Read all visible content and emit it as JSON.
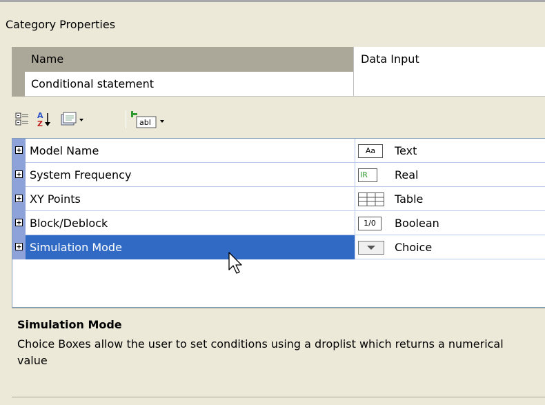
{
  "panel": {
    "title": "Category Properties"
  },
  "category_properties": {
    "header": {
      "label": "Name",
      "value": "Data Input"
    },
    "rows": [
      {
        "label": "Conditional statement",
        "value": ""
      }
    ]
  },
  "toolbar": {
    "categorized_icon": "categorized-view-icon",
    "alphabetical_icon": "alphabetical-sort-icon",
    "property_pages_icon": "property-pages-icon",
    "add_field_label": "abl"
  },
  "properties": [
    {
      "label": "Model Name",
      "type_icon": "Aa",
      "type": "Text"
    },
    {
      "label": "System Frequency",
      "type_icon": "IR",
      "type": "Real"
    },
    {
      "label": "XY Points",
      "type_icon": "",
      "type": "Table"
    },
    {
      "label": "Block/Deblock",
      "type_icon": "1/0",
      "type": "Boolean"
    },
    {
      "label": "Simulation Mode",
      "type_icon": "",
      "type": "Choice",
      "selected": true
    }
  ],
  "description": {
    "title": "Simulation Mode",
    "text": "Choice Boxes allow the user to set conditions using a droplist which returns a numerical value"
  }
}
